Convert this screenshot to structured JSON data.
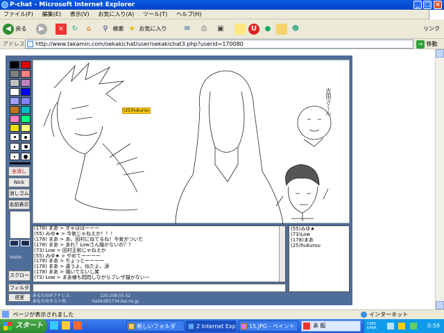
{
  "window": {
    "title": "P-chat - Microsoft Internet Explorer"
  },
  "menu": [
    "ファイル(F)",
    "編集(E)",
    "表示(V)",
    "お気に入り(A)",
    "ツール(T)",
    "ヘルプ(H)"
  ],
  "toolbar": {
    "back": "戻る",
    "search": "検索",
    "favorites": "お気に入り",
    "links": "リンク"
  },
  "address": {
    "label": "アドレス(D)",
    "url": "http://www.takamin.com/oekakichat/user/oekakichat3.php?userid=170080",
    "go": "移動"
  },
  "palette": {
    "colors": [
      "#000000",
      "#e00000",
      "#808080",
      "#ff8080",
      "#c0c0c0",
      "#c080c0",
      "#ffffff",
      "#0000ff",
      "#a0a0ff",
      "#8080ff",
      "#c07820",
      "#00c0c0",
      "#ff80c0",
      "#00ff80",
      "#e8e000",
      "#ffff80"
    ],
    "tools": [
      "全消し",
      "Nick",
      "消しゴム",
      "名前表示"
    ]
  },
  "canvas": {
    "name_tag": "(25)hukurou",
    "side_text": "吉田さ〜ん"
  },
  "chat": {
    "lines": [
      "(178) まあ > ぎゃははーーー",
      "(55) みゆ★ > 今気じゃねえか！！！",
      "(178) まあ > あ、田村に似てるね！今気がついた",
      "(178) まあ > あれ？Lowさん描かないの？？",
      "(73) Low > 田村正和じゃねえか",
      "(55) みゆ★ > やめてーーーー",
      "(178) まあ > ちょっとーーーー",
      "(178) まあ > 違うよ、似たよ、涙",
      "(178) まあ > 描いてないし笑",
      "(73) Low > まあ様も悶悶しながらブレザ描かないー"
    ]
  },
  "users": [
    "(55)みゆ★",
    "(73)Low",
    "(178)まあ",
    "(25)hukurou"
  ],
  "controls": {
    "mark": "MARK",
    "scroll": "スクロール",
    "filter": "フィルタ",
    "exit": "退室"
  },
  "info": {
    "ip_label": "あなたのIPアドレス:",
    "ip_value": "220.208.55.52",
    "host_label": "あなたのホスト名:",
    "host_value": "baldcd02734.bai.ne.jp"
  },
  "status": {
    "text": "ページが表示されました",
    "zone": "インターネット"
  },
  "taskbar": {
    "start": "スタート",
    "tasks": [
      "新しいフォルダ",
      "2 Internet Expl...",
      "15.JPG - ペイント"
    ],
    "ime": "あ 般",
    "caps": "CAPS KANA",
    "clock": "0:59"
  }
}
